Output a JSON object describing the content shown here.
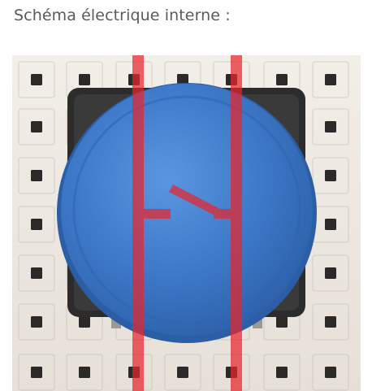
{
  "caption": "Schéma électrique interne :",
  "photo": {
    "subject": "pushbutton-on-breadboard",
    "colors": {
      "breadboard": "#ece7e0",
      "breadboard_shadow": "#bdb6ad",
      "hole": "#2b2a28",
      "button_cap": "#3d78c8",
      "button_cap_dark": "#2b5ea5",
      "button_body": "#2c2c2c",
      "pin": "#9a9a9a",
      "overlay_wire": "#e8262d"
    },
    "overlay_opacity": 0.72
  }
}
